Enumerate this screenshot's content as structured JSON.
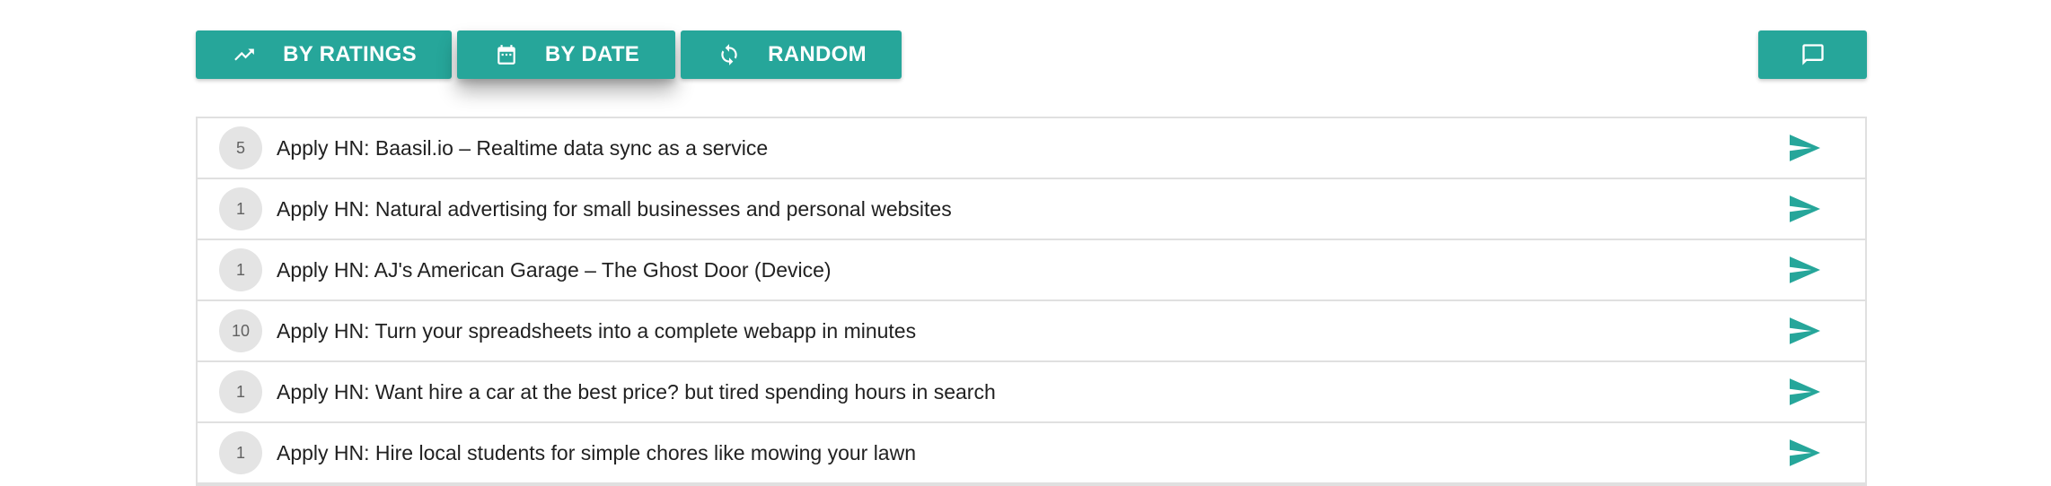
{
  "colors": {
    "accent": "#26a69a",
    "row_border": "#e0e0e0",
    "badge_bg": "#e4e4e4"
  },
  "toolbar": {
    "ratings_label": "BY RATINGS",
    "ratings_icon": "trending-up-icon",
    "date_label": "BY DATE",
    "date_icon": "calendar-icon",
    "random_label": "RANDOM",
    "random_icon": "refresh-icon",
    "comment_icon": "comment-icon"
  },
  "items": [
    {
      "count": "5",
      "title": "Apply HN: Baasil.io – Realtime data sync as a service",
      "action_icon": "send-icon"
    },
    {
      "count": "1",
      "title": "Apply HN: Natural advertising for small businesses and personal websites",
      "action_icon": "send-icon"
    },
    {
      "count": "1",
      "title": "Apply HN: AJ's American Garage – The Ghost Door (Device)",
      "action_icon": "send-icon"
    },
    {
      "count": "10",
      "title": "Apply HN: Turn your spreadsheets into a complete webapp in minutes",
      "action_icon": "send-icon"
    },
    {
      "count": "1",
      "title": "Apply HN: Want hire a car at the best price? but tired spending hours in search",
      "action_icon": "send-icon"
    },
    {
      "count": "1",
      "title": "Apply HN: Hire local students for simple chores like mowing your lawn",
      "action_icon": "send-icon"
    }
  ]
}
